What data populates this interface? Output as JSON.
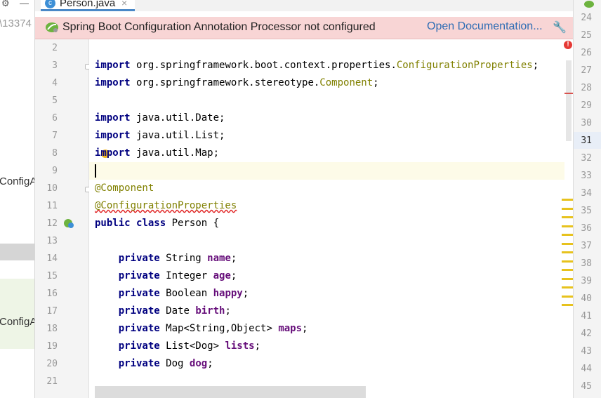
{
  "left_panel": {
    "path_fragment": "\\13374",
    "items": [
      {
        "label": "ConfigA"
      },
      {
        "label": "ConfigA"
      }
    ]
  },
  "tab": {
    "filename": "Person.java",
    "file_type_icon": "c-class-icon",
    "close_glyph": "×"
  },
  "banner": {
    "message": "Spring Boot Configuration Annotation Processor not configured",
    "link": "Open Documentation...",
    "icon": "spring-leaf-icon",
    "settings_icon": "wrench-icon",
    "background": "#f8d5d5"
  },
  "gutter": {
    "line_numbers": [
      "2",
      "3",
      "4",
      "5",
      "6",
      "7",
      "8",
      "9",
      "10",
      "11",
      "12",
      "13",
      "14",
      "15",
      "16",
      "17",
      "18",
      "19",
      "20",
      "21"
    ]
  },
  "code_lines": [
    {
      "n": 2,
      "tokens": []
    },
    {
      "n": 3,
      "tokens": [
        {
          "t": "import",
          "c": "kw"
        },
        {
          "t": " org.springframework.boot.context.properties.",
          "c": ""
        },
        {
          "t": "ConfigurationProperties",
          "c": "cls"
        },
        {
          "t": ";",
          "c": ""
        }
      ]
    },
    {
      "n": 4,
      "tokens": [
        {
          "t": "import",
          "c": "kw"
        },
        {
          "t": " org.springframework.stereotype.",
          "c": ""
        },
        {
          "t": "Component",
          "c": "cls"
        },
        {
          "t": ";",
          "c": ""
        }
      ]
    },
    {
      "n": 5,
      "tokens": []
    },
    {
      "n": 6,
      "tokens": [
        {
          "t": "import",
          "c": "kw"
        },
        {
          "t": " java.util.Date;",
          "c": ""
        }
      ]
    },
    {
      "n": 7,
      "tokens": [
        {
          "t": "import",
          "c": "kw"
        },
        {
          "t": " java.util.List;",
          "c": ""
        }
      ]
    },
    {
      "n": 8,
      "tokens": [
        {
          "t": "import",
          "c": "kw"
        },
        {
          "t": " java.util.Map;",
          "c": ""
        }
      ]
    },
    {
      "n": 9,
      "tokens": []
    },
    {
      "n": 10,
      "tokens": [
        {
          "t": "@Component",
          "c": "ann"
        }
      ]
    },
    {
      "n": 11,
      "tokens": [
        {
          "t": "@ConfigurationProperties",
          "c": "ann squig"
        }
      ]
    },
    {
      "n": 12,
      "tokens": [
        {
          "t": "public",
          "c": "kw"
        },
        {
          "t": " ",
          "c": ""
        },
        {
          "t": "class",
          "c": "kw"
        },
        {
          "t": " Person {",
          "c": ""
        }
      ]
    },
    {
      "n": 13,
      "tokens": []
    },
    {
      "n": 14,
      "tokens": [
        {
          "t": "    ",
          "c": ""
        },
        {
          "t": "private",
          "c": "kw"
        },
        {
          "t": " String ",
          "c": ""
        },
        {
          "t": "name",
          "c": "fld"
        },
        {
          "t": ";",
          "c": ""
        }
      ]
    },
    {
      "n": 15,
      "tokens": [
        {
          "t": "    ",
          "c": ""
        },
        {
          "t": "private",
          "c": "kw"
        },
        {
          "t": " Integer ",
          "c": ""
        },
        {
          "t": "age",
          "c": "fld"
        },
        {
          "t": ";",
          "c": ""
        }
      ]
    },
    {
      "n": 16,
      "tokens": [
        {
          "t": "    ",
          "c": ""
        },
        {
          "t": "private",
          "c": "kw"
        },
        {
          "t": " Boolean ",
          "c": ""
        },
        {
          "t": "happy",
          "c": "fld"
        },
        {
          "t": ";",
          "c": ""
        }
      ]
    },
    {
      "n": 17,
      "tokens": [
        {
          "t": "    ",
          "c": ""
        },
        {
          "t": "private",
          "c": "kw"
        },
        {
          "t": " Date ",
          "c": ""
        },
        {
          "t": "birth",
          "c": "fld"
        },
        {
          "t": ";",
          "c": ""
        }
      ]
    },
    {
      "n": 18,
      "tokens": [
        {
          "t": "    ",
          "c": ""
        },
        {
          "t": "private",
          "c": "kw"
        },
        {
          "t": " Map<String,Object> ",
          "c": ""
        },
        {
          "t": "maps",
          "c": "fld"
        },
        {
          "t": ";",
          "c": ""
        }
      ]
    },
    {
      "n": 19,
      "tokens": [
        {
          "t": "    ",
          "c": ""
        },
        {
          "t": "private",
          "c": "kw"
        },
        {
          "t": " List<Dog> ",
          "c": ""
        },
        {
          "t": "lists",
          "c": "fld"
        },
        {
          "t": ";",
          "c": ""
        }
      ]
    },
    {
      "n": 20,
      "tokens": [
        {
          "t": "    ",
          "c": ""
        },
        {
          "t": "private",
          "c": "kw"
        },
        {
          "t": " Dog ",
          "c": ""
        },
        {
          "t": "dog",
          "c": "fld"
        },
        {
          "t": ";",
          "c": ""
        }
      ]
    },
    {
      "n": 21,
      "tokens": []
    }
  ],
  "current_line": 9,
  "right_panel": {
    "line_numbers": [
      "24",
      "25",
      "26",
      "27",
      "28",
      "29",
      "30",
      "31",
      "32",
      "33",
      "34",
      "35",
      "36",
      "37",
      "38",
      "39",
      "40",
      "41",
      "42",
      "43",
      "44",
      "45"
    ],
    "current_line": "31"
  },
  "colors": {
    "keyword": "#000080",
    "annotation": "#808000",
    "field": "#660e7a",
    "warning_stripe": "#e7c21d",
    "error": "#e53935"
  }
}
